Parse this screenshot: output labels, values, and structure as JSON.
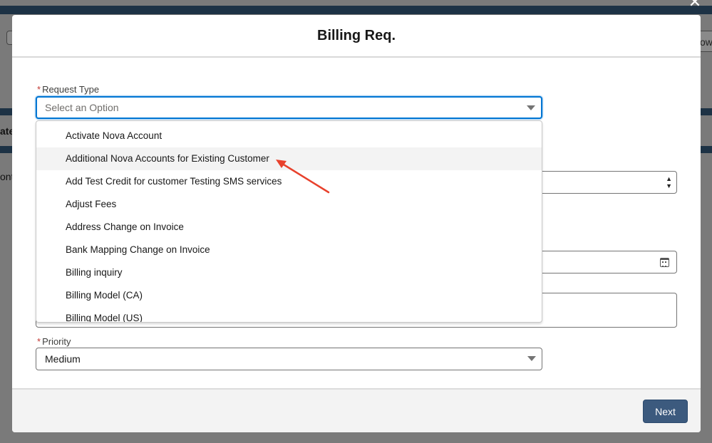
{
  "background": {
    "right_button_text": "ow",
    "left_text_a": "ate",
    "left_text_b": "ont"
  },
  "modal": {
    "title": "Billing Req.",
    "close_glyph": "✕"
  },
  "form": {
    "request_type": {
      "label": "Request Type",
      "required_mark": "*",
      "placeholder": "Select an Option",
      "options": [
        "Activate Nova Account",
        "Additional Nova Accounts for Existing Customer",
        "Add Test Credit for customer Testing SMS services",
        "Adjust Fees",
        "Address Change on Invoice",
        "Bank Mapping Change on Invoice",
        "Billing inquiry",
        "Billing Model (CA)",
        "Billing Model (US)"
      ],
      "hovered_option": "Additional Nova Accounts for Existing Customer"
    },
    "priority": {
      "label": "Priority",
      "required_mark": "*",
      "value": "Medium"
    }
  },
  "footer": {
    "next_label": "Next"
  },
  "icons": {
    "stepper": "stepper-arrows-icon",
    "calendar": "calendar-icon",
    "caret": "chevron-down-icon"
  },
  "colors": {
    "primary_button": "#3c5a7e",
    "focus_border": "#0176d3",
    "required": "#c23934",
    "annotation_arrow": "#e8412c"
  }
}
